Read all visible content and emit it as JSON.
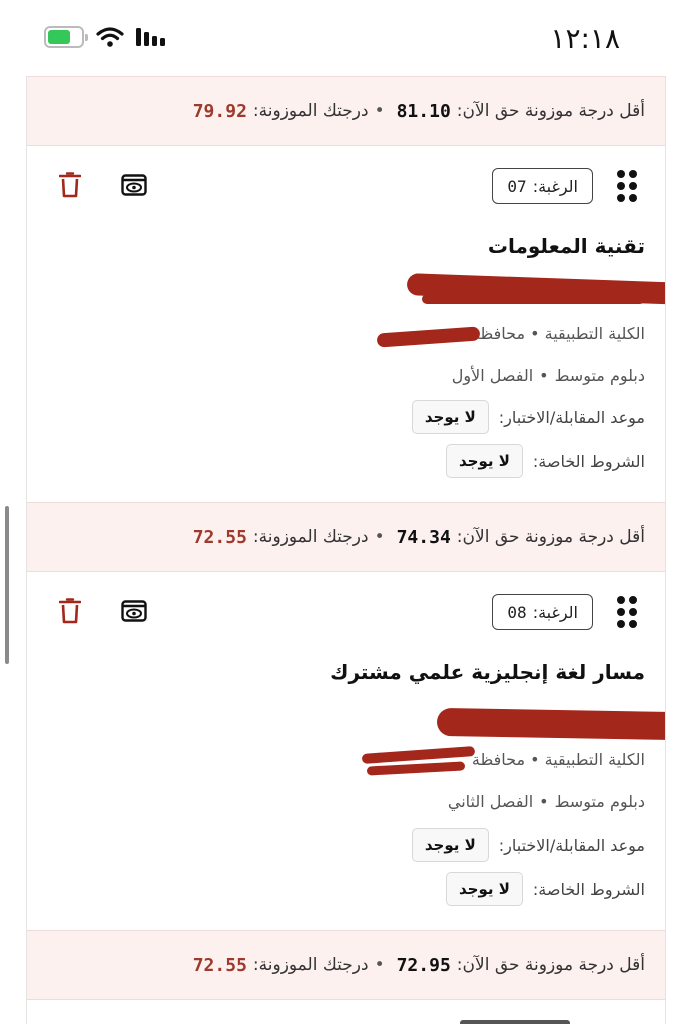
{
  "status_bar": {
    "time": "١٢:١٨"
  },
  "score_label_min": "أقل درجة موزونة حق الآن:",
  "score_label_mine": "درجتك الموزونة:",
  "score_bands": [
    {
      "min": "81.10",
      "mine": "79.92"
    },
    {
      "min": "74.34",
      "mine": "72.55"
    },
    {
      "min": "72.95",
      "mine": "72.55"
    }
  ],
  "cards": [
    {
      "preference_label": "الرغبة:",
      "preference_number": "07",
      "title": "تقنية المعلومات",
      "college_line": "الكلية التطبيقية • محافظة",
      "program_type": "دبلوم متوسط",
      "semester": "الفصل الأول",
      "interview_label": "موعد المقابلة/الاختبار:",
      "interview_value": "لا يوجد",
      "conditions_label": "الشروط الخاصة:",
      "conditions_value": "لا يوجد"
    },
    {
      "preference_label": "الرغبة:",
      "preference_number": "08",
      "title": "مسار لغة إنجليزية علمي مشترك",
      "college_line": "الكلية التطبيقية • محافظة",
      "program_type": "دبلوم متوسط",
      "semester": "الفصل الثاني",
      "interview_label": "موعد المقابلة/الاختبار:",
      "interview_value": "لا يوجد",
      "conditions_label": "الشروط الخاصة:",
      "conditions_value": "لا يوجد"
    }
  ],
  "icons": {
    "drag": "drag-handle-icon",
    "view": "eye-icon",
    "delete": "trash-icon",
    "wifi": "wifi-icon",
    "signal": "signal-icon",
    "battery": "battery-charging-icon"
  },
  "colors": {
    "accent_red": "#9e3a2b",
    "trash_red": "#a3271a",
    "band_bg": "#fdf1f0"
  }
}
